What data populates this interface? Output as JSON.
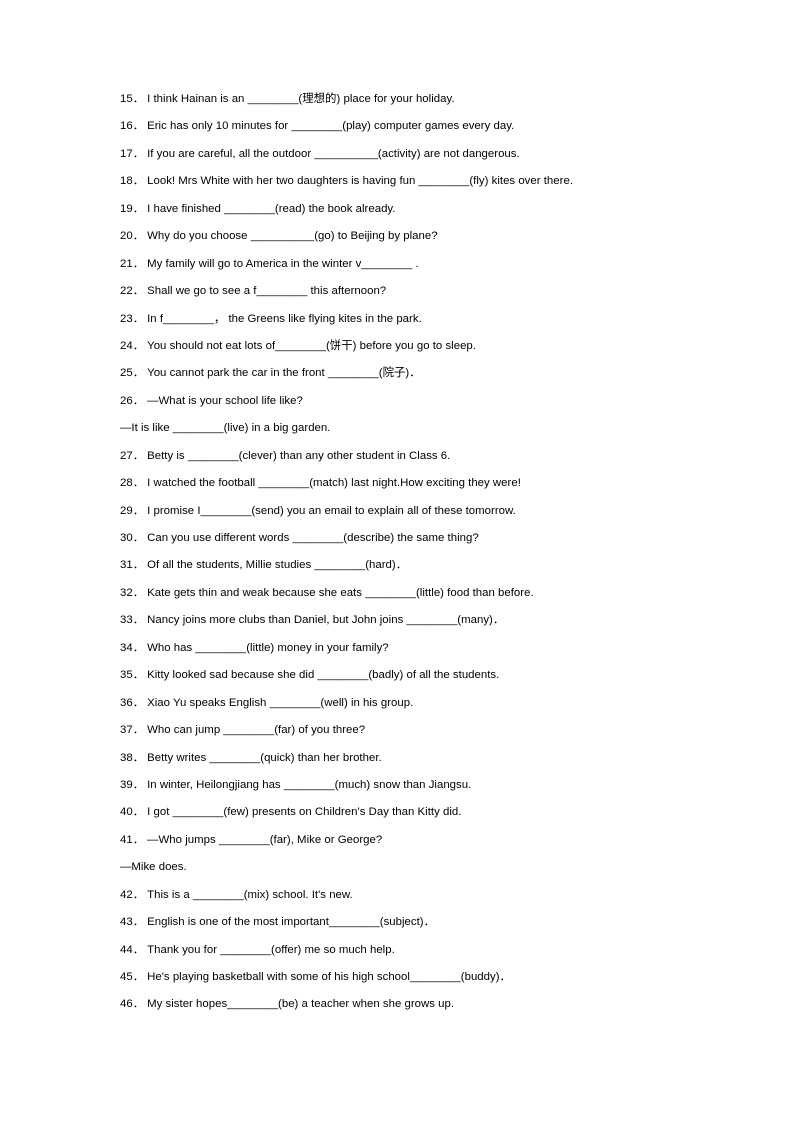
{
  "document": {
    "type": "grammar-worksheet",
    "page_background": "#ffffff",
    "text_color": "#000000",
    "start_number": 15,
    "end_number": 46
  },
  "items": [
    {
      "number": "15．",
      "text": "I think Hainan is an ________(理想的) place for your holiday."
    },
    {
      "number": "16．",
      "text": "Eric has only 10 minutes for ________(play) computer games every day."
    },
    {
      "number": "17．",
      "text": "If you are careful, all the outdoor __________(activity) are not dangerous."
    },
    {
      "number": "18．",
      "text": "Look! Mrs White with her two daughters is having fun ________(fly) kites over there."
    },
    {
      "number": "19．",
      "text": "I have finished ________(read) the book already."
    },
    {
      "number": "20．",
      "text": "Why do you choose __________(go) to Beijing by plane?"
    },
    {
      "number": "21．",
      "text": "My family will go to America in the winter v________ ."
    },
    {
      "number": "22．",
      "text": "Shall we go to see a f________ this afternoon?"
    },
    {
      "number": "23．",
      "text": "In f________，  the Greens like flying kites in the park."
    },
    {
      "number": "24．",
      "text": "You should not eat lots of________(饼干) before you go to sleep."
    },
    {
      "number": "25．",
      "text": "You cannot park the car in the front ________(院子)．"
    },
    {
      "number": "26．",
      "text": "—What is your school life like?"
    },
    {
      "number": "",
      "text": "—It is like ________(live) in a big garden.",
      "continuation": true
    },
    {
      "number": "27．",
      "text": "Betty is ________(clever) than any other student in Class 6."
    },
    {
      "number": "28．",
      "text": "I watched the football ________(match) last night.How exciting they were!"
    },
    {
      "number": "29．",
      "text": "I promise I________(send) you an email to explain all of these tomorrow."
    },
    {
      "number": "30．",
      "text": "Can you use different words ________(describe) the same thing?"
    },
    {
      "number": "31．",
      "text": "Of all the students, Millie studies ________(hard)．"
    },
    {
      "number": "32．",
      "text": "Kate gets thin and weak because she eats ________(little) food than before."
    },
    {
      "number": "33．",
      "text": "Nancy joins more clubs than Daniel, but John joins ________(many)．"
    },
    {
      "number": "34．",
      "text": "Who has ________(little) money in your family?"
    },
    {
      "number": "35．",
      "text": "Kitty looked sad because she did ________(badly) of all the students."
    },
    {
      "number": "36．",
      "text": "Xiao Yu speaks English ________(well) in his group."
    },
    {
      "number": "37．",
      "text": "Who can jump ________(far) of you three?"
    },
    {
      "number": "38．",
      "text": "Betty writes ________(quick) than her brother."
    },
    {
      "number": "39．",
      "text": "In winter, Heilongjiang has ________(much) snow than Jiangsu."
    },
    {
      "number": "40．",
      "text": "I got ________(few) presents on Children's Day than Kitty did."
    },
    {
      "number": "41．",
      "text": "—Who jumps ________(far), Mike or George?"
    },
    {
      "number": "",
      "text": "—Mike does.",
      "continuation": true
    },
    {
      "number": "42．",
      "text": "This is a ________(mix) school. It's new."
    },
    {
      "number": "43．",
      "text": "English is one of the most important________(subject)．"
    },
    {
      "number": "44．",
      "text": "Thank you for ________(offer) me so much help."
    },
    {
      "number": "45．",
      "text": "He's playing basketball with some of his high school________(buddy)．"
    },
    {
      "number": "46．",
      "text": "My sister hopes________(be) a teacher when she grows up."
    }
  ]
}
